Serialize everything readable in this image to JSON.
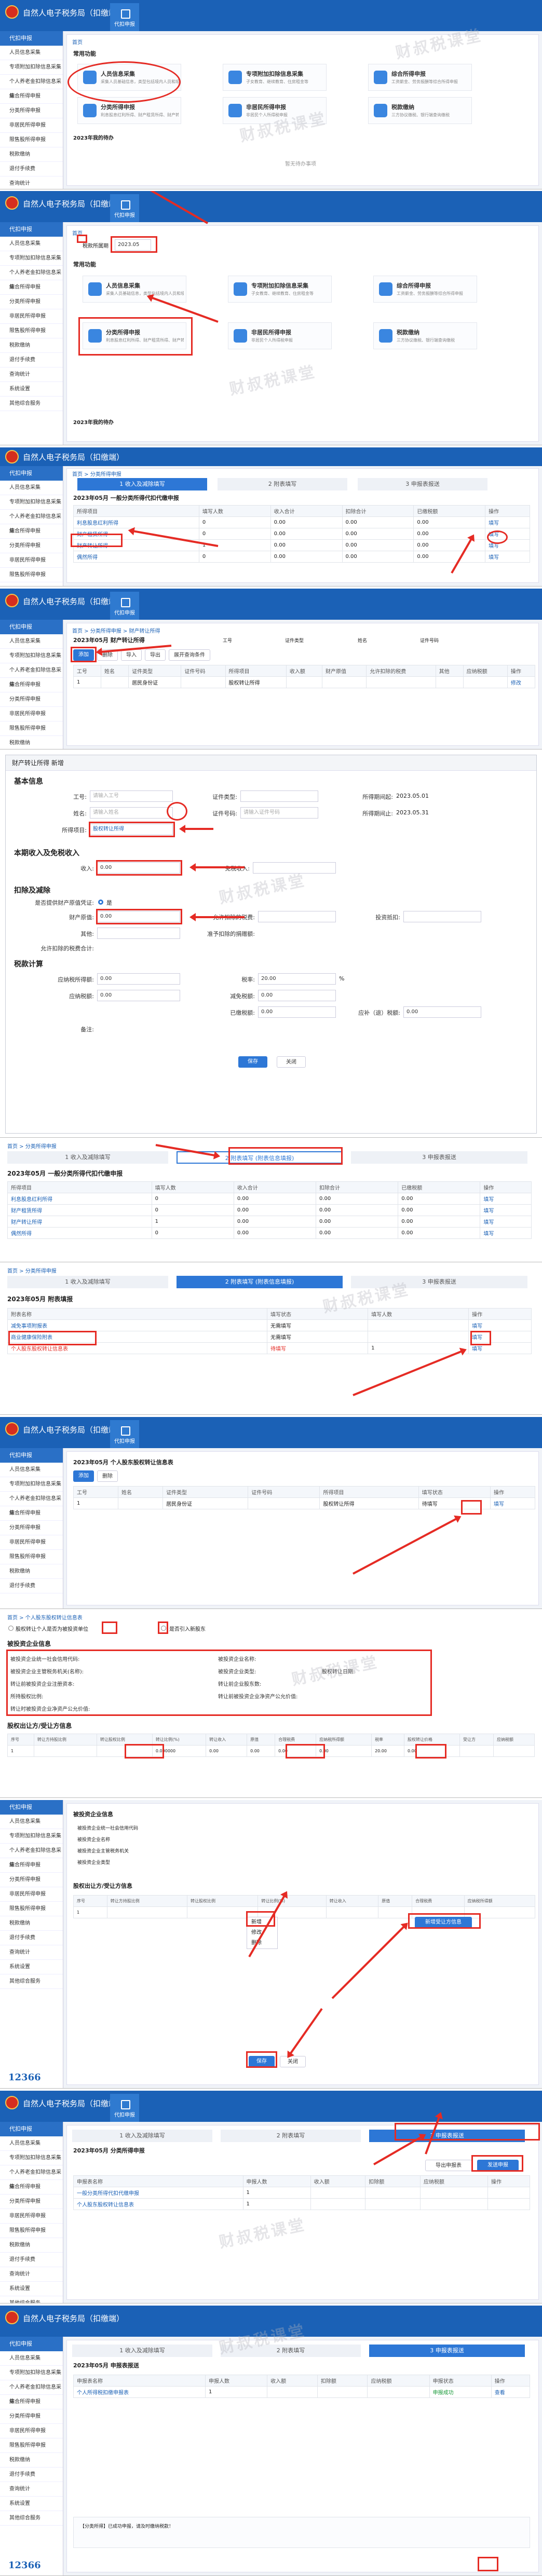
{
  "app": {
    "title": "自然人电子税务局（扣缴端）",
    "tab_icon_label": "代扣申报"
  },
  "watermark": "财叔税课堂",
  "brand": "12366",
  "sidebar": {
    "head": "代扣申报",
    "items": [
      "人员信息采集",
      "专项附加扣除信息采集",
      "个人养老金扣除信息采集",
      "综合所得申报",
      "分类所得申报",
      "非居民所得申报",
      "限售股所得申报",
      "税款缴纳",
      "退付手续费",
      "查询统计",
      "系统设置",
      "其他综合服务"
    ]
  },
  "p1": {
    "breadcrumb": "首页",
    "section": "常用功能",
    "cards": [
      {
        "t": "人员信息采集",
        "s": "采集人员基础信息，类型包括境内人员和境外人员"
      },
      {
        "t": "专项附加扣除信息采集",
        "s": "子女教育、继续教育、住房租金等"
      },
      {
        "t": "综合所得申报",
        "s": "工资薪金、劳务报酬等综合所得申报"
      },
      {
        "t": "分类所得申报",
        "s": "利息股息红利所得、财产租赁所得、财产转让所得"
      },
      {
        "t": "非居民所得申报",
        "s": "非居民个人所得税申报"
      },
      {
        "t": "税款缴纳",
        "s": "三方协议缴税、银行端查询缴税"
      }
    ],
    "notice": "2023年我的待办",
    "empty": "暂无待办事项"
  },
  "p2": {
    "breadcrumb": "首页",
    "tax_period_label": "税款所属期",
    "tax_period": "2023.05",
    "section": "常用功能"
  },
  "p3": {
    "breadcrumb": "首页 > 分类所得申报",
    "steps": [
      "1 收入及减除填写",
      "2 附表填写",
      "3 申报表报送"
    ],
    "title": "2023年05月 一般分类所得代扣代缴申报",
    "cols": [
      "所得项目",
      "填写人数",
      "收入合计",
      "扣除合计",
      "已缴税额",
      "操作"
    ],
    "rows": [
      [
        "利息股息红利所得",
        "0",
        "0.00",
        "0.00",
        "0.00",
        "填写"
      ],
      [
        "财产租赁所得",
        "0",
        "0.00",
        "0.00",
        "0.00",
        "填写"
      ],
      [
        "财产转让所得",
        "1",
        "0.00",
        "0.00",
        "0.00",
        "填写"
      ],
      [
        "偶然所得",
        "0",
        "0.00",
        "0.00",
        "0.00",
        "填写"
      ]
    ],
    "selected": "财产转让所得"
  },
  "p4": {
    "breadcrumb": "首页 > 分类所得申报 > 财产转让所得",
    "title": "2023年05月 财产转让所得",
    "filter_labels": [
      "工号",
      "证件类型",
      "姓名",
      "证件号码"
    ],
    "buttons": [
      "添加",
      "删除",
      "导入",
      "导出",
      "展开查询条件"
    ],
    "cols": [
      "工号",
      "姓名",
      "证件类型",
      "证件号码",
      "所得项目",
      "收入额",
      "财产原值",
      "允许扣除的税费",
      "其他",
      "应纳税额",
      "操作"
    ],
    "row": [
      "1",
      "",
      "居民身份证",
      "",
      "股权转让所得",
      "",
      "",
      "",
      "",
      "",
      "修改"
    ]
  },
  "p5": {
    "dlg_title": "财产转让所得 新增",
    "sec1": "基本信息",
    "f_gonghao": "工号:",
    "f_name": "姓名:",
    "f_item": "所得项目:",
    "item_value": "股权转让所得",
    "f_zjlx": "证件类型:",
    "f_zjhm": "证件号码:",
    "f_start": "所得期间起:",
    "start": "2023.05.01",
    "f_end": "所得期间止:",
    "end": "2023.05.31",
    "placeholder_gonghao": "请输入工号",
    "placeholder_name": "请输入姓名",
    "placeholder_zjhm": "请输入证件号码",
    "sec2": "本期收入及免税收入",
    "f_income": "收入:",
    "income": "0.00",
    "f_mian": "免税收入:",
    "sec3": "扣除及减除",
    "f_yaxi": "是否提供财产原值凭证:",
    "yes": "是",
    "f_yuanzhi": "财产原值:",
    "yuanzhi": "0.00",
    "f_shuifei": "允许扣除的税费:",
    "f_jianchu": "投资抵扣:",
    "f_other": "其他:",
    "f_ljsf": "准予扣除的捐赠额:",
    "f_shebao": "允许扣除的税费合计:",
    "sec4": "税款计算",
    "f_ynssd": "应纳税所得额:",
    "ynssd": "0.00",
    "f_sl": "税率:",
    "sl": "20.00",
    "pct": "%",
    "f_ynse": "应纳税额:",
    "ynse": "0.00",
    "f_jmse": "减免税额:",
    "jmse": "0.00",
    "f_ykse": "已缴税额:",
    "ykse": "0.00",
    "f_ybtse": "应补（退）税额:",
    "ybtse": "0.00",
    "f_bz": "备注:",
    "save": "保存",
    "close": "关闭"
  },
  "p6": {
    "breadcrumb": "首页 > 分类所得申报",
    "steps": [
      "1 收入及减除填写",
      "2 附表填写 (附表信息填报)",
      "3 申报表报送"
    ],
    "title": "2023年05月 一般分类所得代扣代缴申报"
  },
  "p7": {
    "breadcrumb": "首页 > 分类所得申报",
    "title": "2023年05月 附表填报",
    "cols": [
      "附表名称",
      "填写状态",
      "填写人数",
      "操作"
    ],
    "rows": [
      [
        "减免事项附报表",
        "无需填写",
        "",
        "填写"
      ],
      [
        "商业健康保险附表",
        "无需填写",
        "",
        "填写"
      ],
      [
        "个人股东股权转让信息表",
        "待填写",
        "1",
        "填写"
      ]
    ]
  },
  "p8": {
    "title": "2023年05月 个人股东股权转让信息表",
    "cols": [
      "工号",
      "姓名",
      "证件类型",
      "证件号码",
      "所得项目",
      "填写状态",
      "操作"
    ],
    "row": [
      "1",
      "",
      "居民身份证",
      "",
      "股权转让所得",
      "待填写",
      "填写"
    ]
  },
  "p9": {
    "breadcrumb": "首页 > 个人股东股权转让信息表",
    "q1": "股权转让个人是否为被投资单位",
    "q2": "是否引入新股东",
    "sec1": "被投资企业信息",
    "labels": [
      "被投资企业统一社会信用代码:",
      "被投资企业名称:",
      "被投资企业主管税务机关(名称):",
      "被投资企业类型:",
      "转让前被投资企业注册资本:",
      "转让前企业股东数:",
      "所持股权比例:",
      "转让前被投资企业净资产公允价值:",
      "转让时被投资企业净资产公允价值:",
      "股权转让日期:"
    ],
    "sec2": "股权出让方/受让方信息",
    "tcols": [
      "序号",
      "转让方持股比例",
      "转让股权比例",
      "转让比例(%)",
      "转让收入",
      "原值",
      "合理税费",
      "应纳税所得额",
      "税率",
      "股权转让价格",
      "受让方",
      "应纳税额"
    ],
    "trow": [
      "1",
      "",
      "",
      "0.000000",
      "0.00",
      "0.00",
      "0.00",
      "0.00",
      "20.00",
      "0.00",
      "",
      ""
    ]
  },
  "p10": {
    "labels": [
      "被投资企业统一社会信用代码",
      "被投资企业名称",
      "被投资企业主管税务机关",
      "被投资企业类型"
    ],
    "sec": "股权出让方/受让方信息",
    "menu": [
      "新增",
      "修改",
      "删除"
    ],
    "btn_add": "新增受让方信息",
    "save": "保存",
    "close": "关闭"
  },
  "p11": {
    "steps": [
      "1 收入及减除填写",
      "2 附表填写",
      "3 申报表报送"
    ],
    "title": "2023年05月 分类所得申报",
    "btns": [
      "导出申报表",
      "发送申报"
    ],
    "cols": [
      "申报表名称",
      "申报人数",
      "收入额",
      "扣除额",
      "应纳税额",
      "操作"
    ],
    "rows": [
      [
        "一般分类所得代扣代缴申报",
        "1",
        "",
        "",
        "",
        ""
      ],
      [
        "个人股东股权转让信息表",
        "1",
        "",
        "",
        "",
        ""
      ]
    ]
  },
  "p12": {
    "steps": [
      "1 收入及减除填写",
      "2 附表填写",
      "3 申报表报送"
    ],
    "title": "2023年05月 申报表报送",
    "cols": [
      "申报表名称",
      "申报人数",
      "收入额",
      "扣除额",
      "应纳税额",
      "申报状态",
      "操作"
    ],
    "rows": [
      [
        "个人所得税扣缴申报表",
        "1",
        "",
        "",
        "",
        "申报成功",
        "查看"
      ]
    ],
    "msg": "【分类所得】已成功申报，请及时缴纳税款！"
  }
}
